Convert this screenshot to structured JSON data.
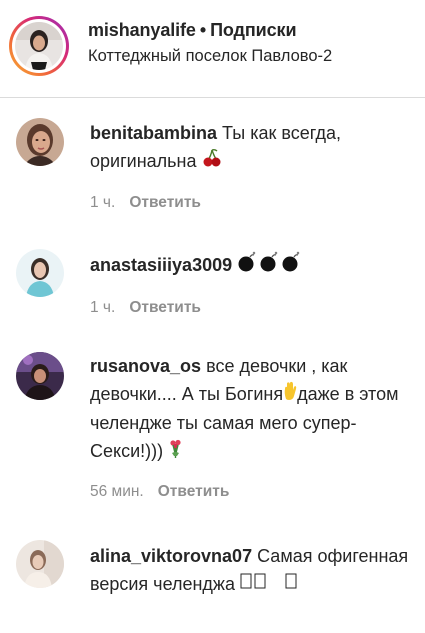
{
  "header": {
    "username": "mishanyalife",
    "separator": "•",
    "follow_label": "Подписки",
    "location": "Коттеджный поселок Павлово-2"
  },
  "comments": [
    {
      "username": "benitabambina",
      "text": "Ты как всегда, оригинальна",
      "emoji": "cherries",
      "time": "1 ч.",
      "reply_label": "Ответить"
    },
    {
      "username": "anastasiiiya3009",
      "text": "",
      "emoji": "bomb bomb bomb",
      "time": "1 ч.",
      "reply_label": "Ответить"
    },
    {
      "username": "rusanova_os",
      "text_part1": "все девочки , как девочки.... А ты Богиня",
      "text_part2": "даже в этом челендже ты самая мего супер-Секси!)))",
      "emoji": "waving-hand bouquet",
      "time": "56 мин.",
      "reply_label": "Ответить"
    },
    {
      "username": "alina_viktorovna07",
      "text": "Самая офигенная версия челенджа",
      "emoji": "missing-glyph x3",
      "time": "",
      "reply_label": ""
    }
  ],
  "colors": {
    "text": "#262626",
    "meta": "#8e8e8e",
    "divider": "#dbdbdb"
  }
}
